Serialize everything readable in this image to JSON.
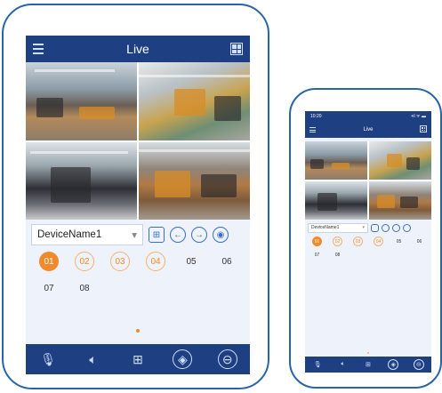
{
  "tablet": {
    "header": {
      "title": "Live",
      "menu_icon": "menu-icon",
      "layout_icon": "grid-layout-icon"
    },
    "device_bar": {
      "device_name": "DeviceName1",
      "caret": "▾"
    },
    "channels": [
      {
        "label": "01",
        "state": "active"
      },
      {
        "label": "02",
        "state": "pending"
      },
      {
        "label": "03",
        "state": "pending"
      },
      {
        "label": "04",
        "state": "pending"
      },
      {
        "label": "05",
        "state": "idle"
      },
      {
        "label": "06",
        "state": "idle"
      },
      {
        "label": "07",
        "state": "idle"
      },
      {
        "label": "08",
        "state": "idle"
      }
    ],
    "toolbar": [
      "microphone-icon",
      "speaker-icon",
      "split-screen-icon",
      "ptz-icon",
      "stop-icon"
    ]
  },
  "phone": {
    "status_bar": {
      "time": "10:20",
      "indicators": "•ıl ᯤ ▬"
    },
    "header": {
      "title": "Live"
    },
    "device_bar": {
      "device_name": "DeviceName1",
      "caret": "▾"
    },
    "channels": [
      {
        "label": "01",
        "state": "active"
      },
      {
        "label": "02",
        "state": "pending"
      },
      {
        "label": "03",
        "state": "pending"
      },
      {
        "label": "04",
        "state": "pending"
      },
      {
        "label": "05",
        "state": "idle"
      },
      {
        "label": "06",
        "state": "idle"
      },
      {
        "label": "07",
        "state": "idle"
      },
      {
        "label": "08",
        "state": "idle"
      }
    ]
  },
  "colors": {
    "navy": "#1e3f82",
    "accent": "#f08a2a",
    "outline": "#2a64a8"
  }
}
